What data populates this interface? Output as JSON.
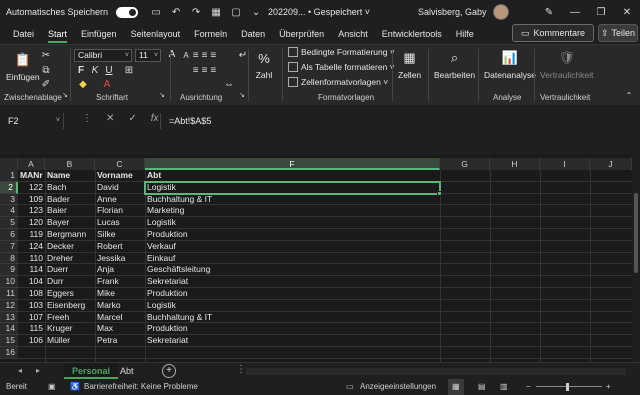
{
  "titlebar": {
    "autosave_label": "Automatisches Speichern",
    "doc_title": "202209... • Gespeichert ˅",
    "user_name": "Salvisberg, Gaby"
  },
  "menu": {
    "tabs": [
      "Datei",
      "Start",
      "Einfügen",
      "Seitenlayout",
      "Formeln",
      "Daten",
      "Überprüfen",
      "Ansicht",
      "Entwicklertools",
      "Hilfe"
    ],
    "comments_label": "Kommentare",
    "share_label": "Teilen"
  },
  "ribbon": {
    "paste_label": "Einfügen",
    "clipboard_group": "Zwischenablage",
    "font_name": "Calibri",
    "font_size": "11",
    "font_group": "Schriftart",
    "alignment_group": "Ausrichtung",
    "number_label": "Zahl",
    "cond_format": "Bedingte Formatierung ˅",
    "table_format": "Als Tabelle formatieren ˅",
    "cell_styles": "Zellenformatvorlagen ˅",
    "styles_group": "Formatvorlagen",
    "cells_label": "Zellen",
    "edit_label": "Bearbeiten",
    "analyze_label": "Datenanalyse",
    "analysis_group": "Analyse",
    "sensitivity_label": "Vertraulichkeit",
    "sensitivity_group": "Vertraulichkeit"
  },
  "formula": {
    "namebox": "F2",
    "content": "=Abt!$A$5"
  },
  "grid": {
    "columns": [
      "A",
      "B",
      "C",
      "F",
      "G",
      "H",
      "I",
      "J"
    ],
    "headers": [
      "MANr",
      "Name",
      "Vorname",
      "Abt"
    ],
    "rows": [
      [
        "122",
        "Bach",
        "David",
        "Logistik"
      ],
      [
        "109",
        "Bader",
        "Anne",
        "Buchhaltung & IT"
      ],
      [
        "123",
        "Baier",
        "Florian",
        "Marketing"
      ],
      [
        "120",
        "Bayer",
        "Lucas",
        "Logistik"
      ],
      [
        "119",
        "Bergmann",
        "Silke",
        "Produktion"
      ],
      [
        "124",
        "Decker",
        "Robert",
        "Verkauf"
      ],
      [
        "110",
        "Dreher",
        "Jessika",
        "Einkauf"
      ],
      [
        "114",
        "Duerr",
        "Anja",
        "Geschäftsleitung"
      ],
      [
        "104",
        "Durr",
        "Frank",
        "Sekretariat"
      ],
      [
        "108",
        "Eggers",
        "Mike",
        "Produktion"
      ],
      [
        "103",
        "Eisenberg",
        "Marko",
        "Logistik"
      ],
      [
        "107",
        "Freeh",
        "Marcel",
        "Buchhaltung & IT"
      ],
      [
        "115",
        "Kruger",
        "Max",
        "Produktion"
      ],
      [
        "106",
        "Müller",
        "Petra",
        "Sekretariat"
      ]
    ]
  },
  "sheets": {
    "tabs": [
      "Personal",
      "Abt"
    ],
    "active": "Personal"
  },
  "status": {
    "ready": "Bereit",
    "accessibility": "Barrierefreiheit: Keine Probleme",
    "display_settings": "Anzeigeeinstellungen"
  }
}
